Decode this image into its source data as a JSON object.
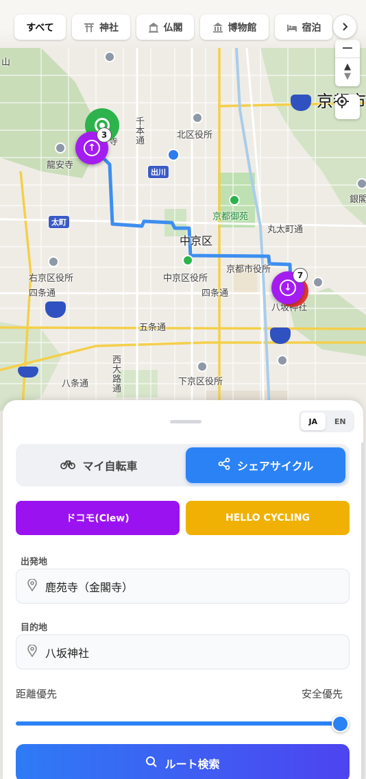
{
  "categories": {
    "items": [
      {
        "label": "すべて",
        "icon": "none",
        "active": true
      },
      {
        "label": "神社",
        "icon": "torii-icon"
      },
      {
        "label": "仏閣",
        "icon": "temple-icon"
      },
      {
        "label": "博物館",
        "icon": "museum-icon"
      },
      {
        "label": "宿泊",
        "icon": "bed-icon"
      }
    ],
    "next_icon": "chevron-right-icon"
  },
  "map": {
    "labels": {
      "kyoto_city": "京都市",
      "nakagyo_ku": "中京区",
      "kita_ward_office": "北区役所",
      "ryoanji": "龍安寺",
      "gosho": "京都御苑",
      "marutamachi": "丸太町通",
      "city_hall": "京都市役所",
      "nakagyo_office": "中京区役所",
      "ukyo_office": "右京区役所",
      "shijo_left": "四条通",
      "shijo_right": "四条通",
      "yasaka": "八坂神社",
      "gojo": "五条通",
      "hachijo": "八条通",
      "shimogyo_office": "下京区役所",
      "nishioji": "西大路通",
      "senbon": "千本通",
      "ginkaku": "銀閣",
      "ji_fragment": "寺",
      "yama_fragment": "山",
      "taimachi_badge": "太町",
      "demizu_badge": "出川"
    },
    "start_marker_icon": "start-target-icon",
    "cluster_a_count": "3",
    "cluster_b_count": "7",
    "cluster_a_icon": "arrow-up-icon",
    "cluster_b_icon": "arrow-down-icon",
    "zoom_out": "−",
    "compass_icon": "compass-icon",
    "locate_icon": "locate-icon",
    "route_color": "#3d8ef0"
  },
  "panel": {
    "lang": {
      "ja": "JA",
      "en": "EN",
      "selected": "JA"
    },
    "mode": {
      "my_bike": "マイ自転車",
      "share_cycle": "シェアサイクル",
      "selected": "share_cycle"
    },
    "operators": {
      "docomo": "ドコモ(Clew)",
      "hello": "HELLO CYCLING"
    },
    "origin": {
      "label": "出発地",
      "value": "鹿苑寺（金閣寺）"
    },
    "destination": {
      "label": "目的地",
      "value": "八坂神社"
    },
    "priority": {
      "left": "距離優先",
      "right": "安全優先",
      "value": 1.0
    },
    "search_button": "ルート検索"
  },
  "colors": {
    "accent_blue": "#2b82f5",
    "docomo_purple": "#9b12f0",
    "hello_yellow": "#f0b104",
    "start_green": "#2db34c",
    "cluster_purple": "#a41df0"
  }
}
